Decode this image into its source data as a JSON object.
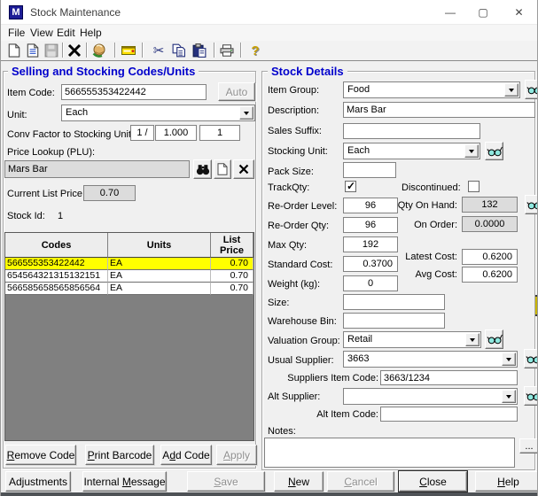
{
  "window": {
    "title": "Stock Maintenance",
    "icon_letter": "M",
    "minimize": "—",
    "maximize": "▢",
    "close": "✕"
  },
  "menu": {
    "items": [
      "File",
      "View",
      "Edit",
      "Help"
    ]
  },
  "toolbar": {
    "icons": [
      "new-document",
      "open-document",
      "save",
      "delete",
      "stock-globe",
      "internal-message",
      "cut",
      "copy",
      "paste",
      "print",
      "help"
    ],
    "help_glyph": "?",
    "cut_glyph": "✂"
  },
  "left_panel": {
    "title": "Selling and Stocking Codes/Units",
    "item_code_label": "Item Code:",
    "item_code_value": "566555353422442",
    "auto_button": {
      "label": "Auto",
      "mnemonic": -1
    },
    "unit_label": "Unit:",
    "unit_value": "Each",
    "conv_factor_label": "Conv Factor to Stocking Unit:",
    "conv_factor_1": "1 /",
    "conv_factor_2": "1.000",
    "conv_factor_3": "1",
    "plu_label": "Price Lookup (PLU):",
    "plu_value": "Mars Bar",
    "current_list_price_label": "Current List Price:",
    "current_list_price_value": "0.70",
    "stock_id_label": "Stock Id:",
    "stock_id_value": "1",
    "codes_table": {
      "headers": [
        "Codes",
        "Units",
        "List Price"
      ],
      "rows": [
        [
          "566555353422442",
          "EA",
          "0.70"
        ],
        [
          "654564321315132151",
          "EA",
          "0.70"
        ],
        [
          "566585658565856564",
          "EA",
          "0.70"
        ]
      ],
      "selected_row_index": 0
    },
    "buttons": {
      "remove": {
        "label": "Remove Code",
        "mnemonic": 0
      },
      "print_barcode": {
        "label": "Print Barcode",
        "mnemonic": 0
      },
      "add": {
        "label": "Add Code",
        "mnemonic": 1
      },
      "apply": {
        "label": "Apply",
        "mnemonic": 0
      }
    }
  },
  "right_panel": {
    "title": "Stock Details",
    "item_group_label": "Item Group:",
    "item_group_value": "Food",
    "description_label": "Description:",
    "description_value": "Mars Bar",
    "sales_suffix_label": "Sales Suffix:",
    "sales_suffix_value": "",
    "stocking_unit_label": "Stocking Unit:",
    "stocking_unit_value": "Each",
    "pack_size_label": "Pack Size:",
    "pack_size_value": "",
    "track_qty_label": "TrackQty:",
    "track_qty_checked": true,
    "discontinued_label": "Discontinued:",
    "discontinued_checked": false,
    "reorder_level_label": "Re-Order Level:",
    "reorder_level_value": "96",
    "qty_on_hand_label": "Qty On Hand:",
    "qty_on_hand_value": "132",
    "reorder_qty_label": "Re-Order Qty:",
    "reorder_qty_value": "96",
    "on_order_label": "On Order:",
    "on_order_value": "0.0000",
    "max_qty_label": "Max Qty:",
    "max_qty_value": "192",
    "standard_cost_label": "Standard Cost:",
    "standard_cost_value": "0.3700",
    "latest_cost_label": "Latest Cost:",
    "latest_cost_value": "0.6200",
    "weight_label": "Weight (kg):",
    "weight_value": "0",
    "avg_cost_label": "Avg Cost:",
    "avg_cost_value": "0.6200",
    "size_label": "Size:",
    "size_value": "",
    "warehouse_bin_label": "Warehouse Bin:",
    "warehouse_bin_value": "",
    "valuation_group_label": "Valuation Group:",
    "valuation_group_value": "Retail",
    "usual_supplier_label": "Usual Supplier:",
    "usual_supplier_value": "3663",
    "suppliers_item_code_label": "Suppliers Item Code:",
    "suppliers_item_code_value": "3663/1234",
    "alt_supplier_label": "Alt Supplier:",
    "alt_supplier_value": "",
    "alt_item_code_label": "Alt Item Code:",
    "alt_item_code_value": "",
    "notes_label": "Notes:",
    "notes_value": "",
    "notes_more_button": "..."
  },
  "bottom_bar": {
    "adjustments": {
      "label": "Adjustments",
      "mnemonic": -1
    },
    "internal_message": {
      "label": "Internal Message",
      "mnemonic": 9
    },
    "save": {
      "label": "Save",
      "mnemonic": 0
    },
    "new": {
      "label": "New",
      "mnemonic": 0
    },
    "cancel": {
      "label": "Cancel",
      "mnemonic": 0
    },
    "close": {
      "label": "Close",
      "mnemonic": 0
    },
    "help": {
      "label": "Help",
      "mnemonic": 0
    }
  },
  "colors": {
    "group_title": "#0000cc",
    "selected_row": "#ffff00",
    "grid_filler": "#808080",
    "readonly_bg": "#dcdcdc"
  }
}
